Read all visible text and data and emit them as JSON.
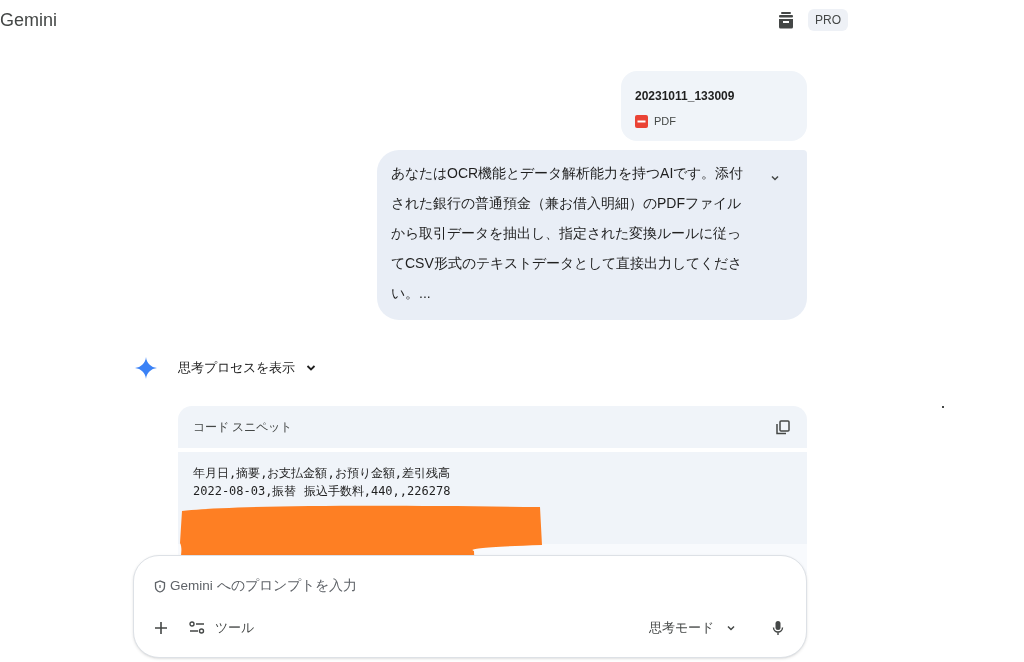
{
  "header": {
    "title": "Gemini",
    "badge": "PRO"
  },
  "attachment": {
    "name": "20231011_133009",
    "type": "PDF"
  },
  "prompt": {
    "text": "あなたはOCR機能とデータ解析能力を持つAIです。添付された銀行の普通預金（兼お借入明細）のPDFファイルから取引データを抽出し、指定された変換ルールに従ってCSV形式のテキストデータとして直接出力してください。...",
    "expanded": false
  },
  "response": {
    "thinking_label": "思考プロセスを表示",
    "code": {
      "title": "コード スニペット",
      "lines": [
        "年月日,摘要,お支払金額,お預り金額,差引残高",
        "2022-08-03,振替 振込手数料,440,,226278"
      ]
    }
  },
  "input": {
    "placeholder": "Gemini へのプロンプトを入力",
    "tools_label": "ツール",
    "mode_label": "思考モード"
  }
}
